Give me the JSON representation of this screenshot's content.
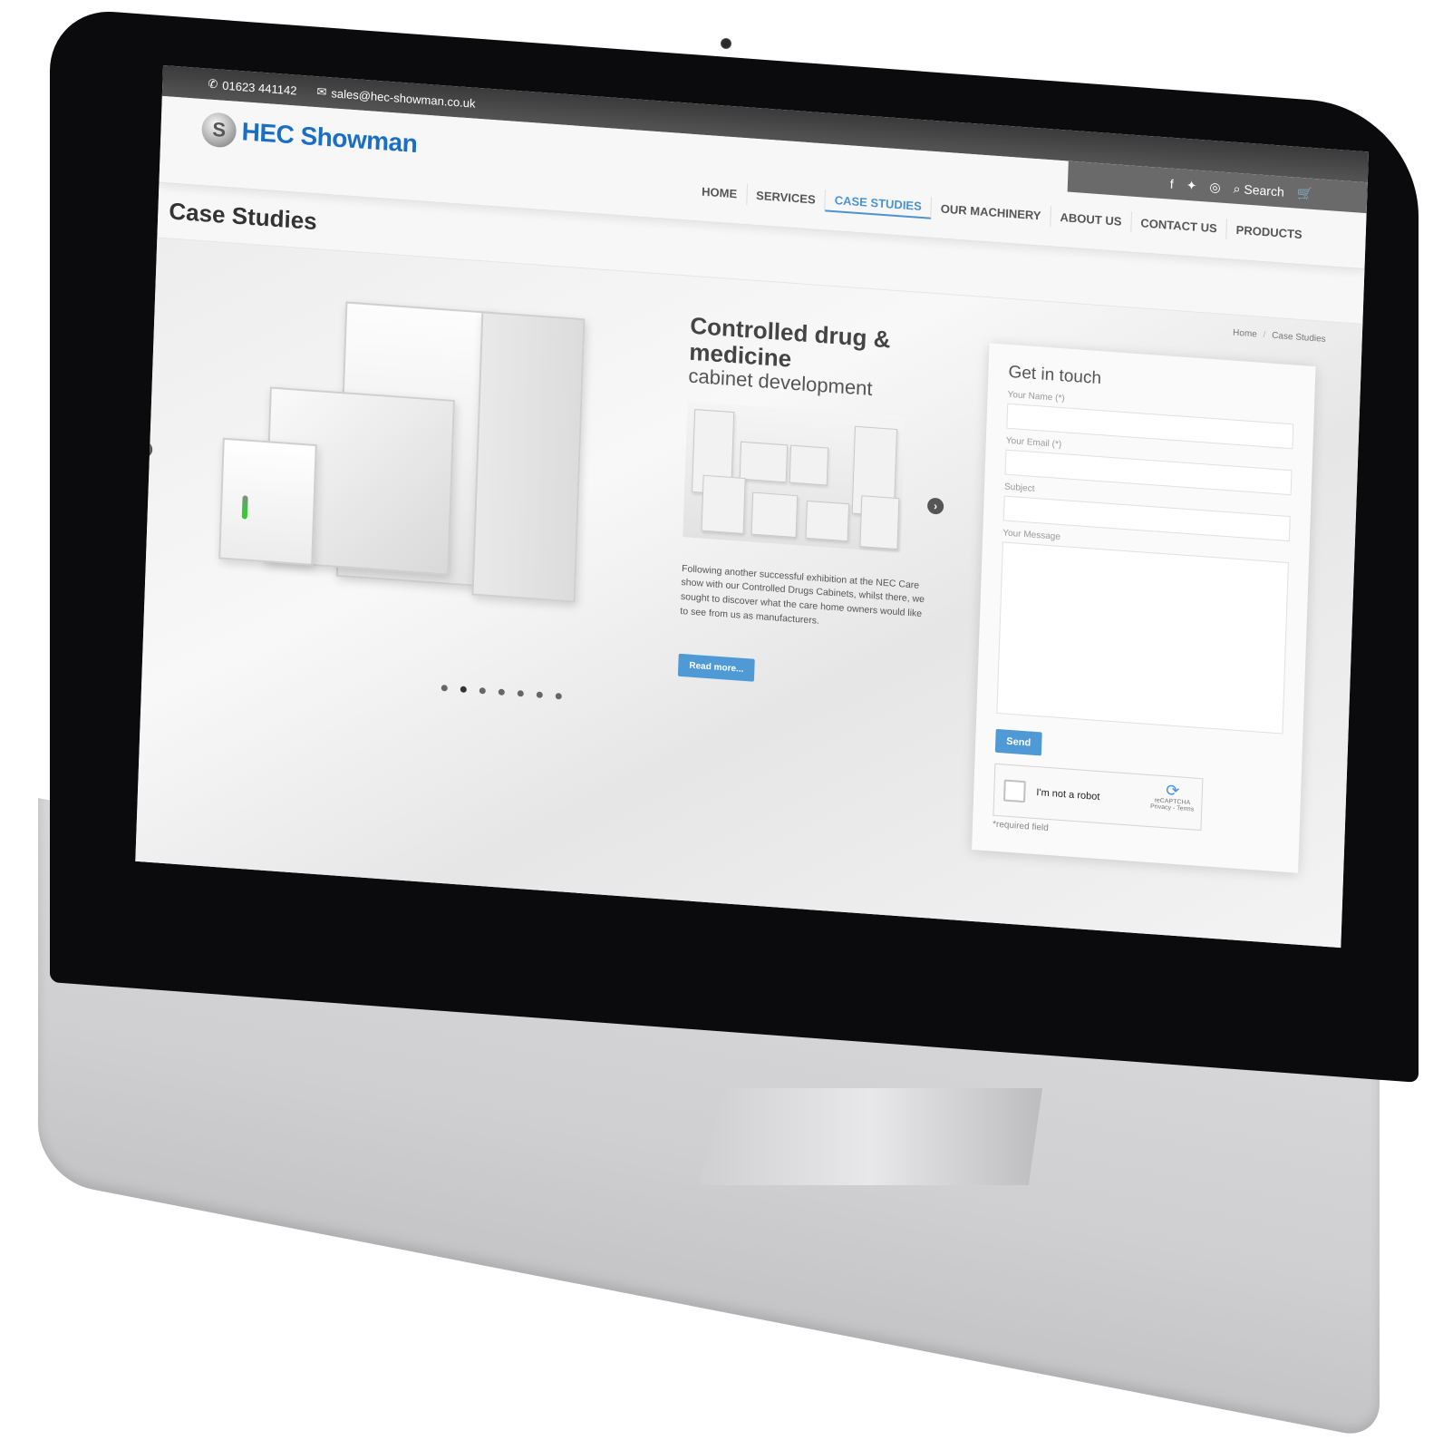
{
  "topbar": {
    "phone_icon": "phone-icon",
    "phone": "01623 441142",
    "email_icon": "envelope-icon",
    "email": "sales@hec-showman.co.uk"
  },
  "social": {
    "facebook": "f",
    "twitter": "🐦",
    "instagram": "◎",
    "search_label": "Search",
    "cart_icon": "cart-icon"
  },
  "brand": {
    "name": "HEC Showman",
    "color": "#1a6fc4"
  },
  "nav": {
    "items": [
      {
        "label": "HOME"
      },
      {
        "label": "SERVICES"
      },
      {
        "label": "CASE STUDIES",
        "active": true
      },
      {
        "label": "OUR MACHINERY"
      },
      {
        "label": "ABOUT US"
      },
      {
        "label": "CONTACT US"
      },
      {
        "label": "PRODUCTS"
      }
    ],
    "active_color": "#4a93d1"
  },
  "page": {
    "title": "Case Studies",
    "breadcrumb": {
      "home": "Home",
      "separator": "/",
      "current": "Case Studies"
    }
  },
  "slider": {
    "prev_icon": "‹",
    "next_icon": "›",
    "heading_line1": "Controlled drug &",
    "heading_line2": "medicine",
    "subheading": "cabinet development",
    "paragraph": "Following another successful exhibition at the NEC Care show with our Controlled Drugs Cabinets, whilst there, we sought to discover what the care home owners would like to see from us as manufacturers.",
    "read_more": "Read more...",
    "total_slides": 7,
    "active_slide": 2
  },
  "contact_form": {
    "title": "Get in touch",
    "name_label": "Your Name (*)",
    "name_value": "",
    "email_label": "Your Email (*)",
    "email_value": "",
    "subject_label": "Subject",
    "subject_value": "",
    "message_label": "Your Message",
    "message_value": "",
    "send_label": "Send",
    "recaptcha_label": "I'm not a robot",
    "recaptcha_brand": "reCAPTCHA",
    "recaptcha_links": "Privacy - Terms",
    "required_note": "*required field",
    "button_color": "#4f9ad4"
  }
}
